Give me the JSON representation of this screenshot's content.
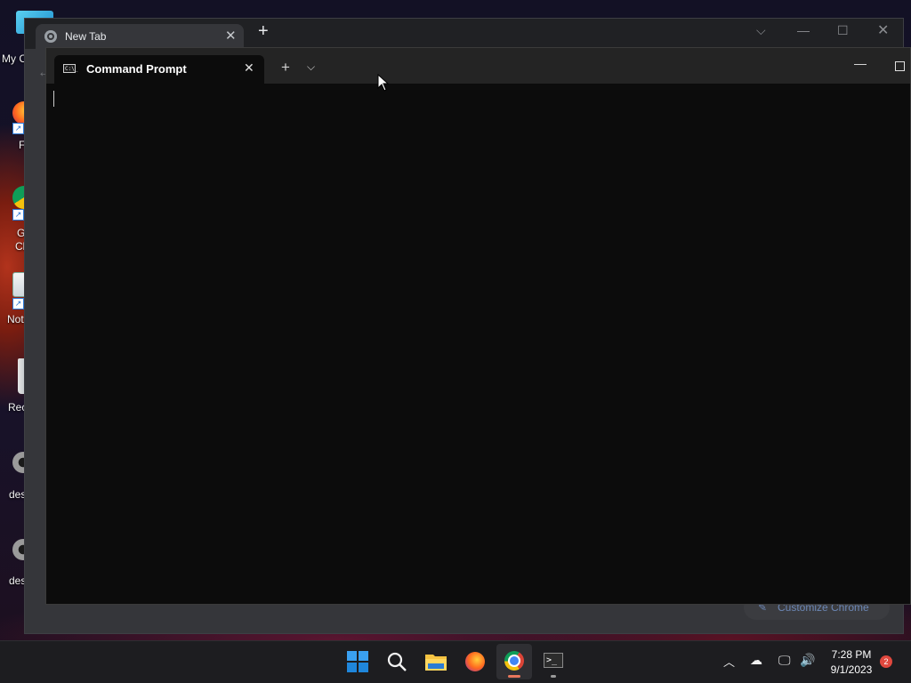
{
  "desktop": {
    "icons": [
      {
        "label": "My C",
        "icon": "this-pc-icon"
      },
      {
        "label": "F",
        "icon": "firefox-icon"
      },
      {
        "label": "G",
        "label2": "Cl",
        "icon": "chrome-icon"
      },
      {
        "label": "Not",
        "icon": "notepad-icon"
      },
      {
        "label": "Rec",
        "icon": "recycle-bin-icon"
      },
      {
        "label": "des",
        "icon": "gear-icon"
      },
      {
        "label": "des",
        "icon": "gear-icon"
      }
    ]
  },
  "chrome": {
    "tab_title": "New Tab",
    "customize_label": "Customize Chrome"
  },
  "terminal": {
    "tab_title": "Command Prompt",
    "tab_icon_text": "C:\\_"
  },
  "taskbar": {
    "apps": [
      "start-icon",
      "search-icon",
      "file-explorer-icon",
      "firefox-icon",
      "chrome-icon",
      "terminal-icon"
    ],
    "clock": {
      "time": "7:28 PM",
      "date": "9/1/2023"
    },
    "notifications": "2"
  },
  "colors": {
    "terminal_bg": "#0c0c0c",
    "terminal_titlebar": "#242424",
    "chrome_frame": "#202124",
    "taskbar_bg": "#1d1d20",
    "accent_indicator": "#e8765c",
    "badge": "#e0483e"
  }
}
